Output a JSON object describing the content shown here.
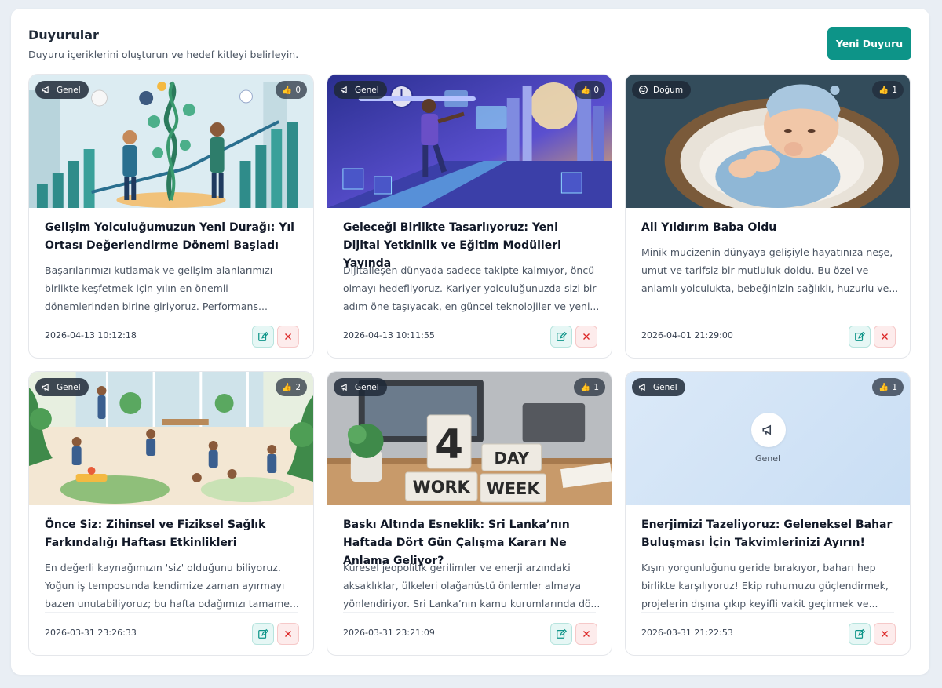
{
  "header": {
    "title": "Duyurular",
    "subtitle": "Duyuru içeriklerini oluşturun ve hedef kitleyi belirleyin.",
    "new_button": "Yeni Duyuru"
  },
  "colors": {
    "accent": "#0d9488",
    "delete": "#dc2626"
  },
  "cards": [
    {
      "category": "Genel",
      "category_icon": "megaphone-icon",
      "likes": "0",
      "title": "Gelişim Yolculuğumuzun Yeni Durağı: Yıl Ortası Değerlendirme Dönemi Başladı",
      "description": "Başarılarımızı kutlamak ve gelişim alanlarımızı birlikte keşfetmek için yılın en önemli dönemlerinden birine giriyoruz. Performans...",
      "date": "2026-04-13 10:12:18"
    },
    {
      "category": "Genel",
      "category_icon": "megaphone-icon",
      "likes": "0",
      "title": "Geleceği Birlikte Tasarlıyoruz: Yeni Dijital Yetkinlik ve Eğitim Modülleri Yayında",
      "description": "Dijitalleşen dünyada sadece takipte kalmıyor, öncü olmayı hedefliyoruz. Kariyer yolculuğunuzda sizi bir adım öne taşıyacak, en güncel teknolojiler ve yeni...",
      "date": "2026-04-13 10:11:55"
    },
    {
      "category": "Doğum",
      "category_icon": "smile-icon",
      "likes": "1",
      "title": "Ali Yıldırım Baba Oldu",
      "description": "Minik mucizenin dünyaya gelişiyle hayatınıza neşe, umut ve tarifsiz bir mutluluk doldu. Bu özel ve anlamlı yolculukta, bebeğinizin sağlıklı, huzurlu ve...",
      "date": "2026-04-01 21:29:00"
    },
    {
      "category": "Genel",
      "category_icon": "megaphone-icon",
      "likes": "2",
      "title": "Önce Siz: Zihinsel ve Fiziksel Sağlık Farkındalığı Haftası Etkinlikleri",
      "description": "En değerli kaynağımızın 'siz' olduğunu biliyoruz. Yoğun iş temposunda kendimize zaman ayırmayı bazen unutabiliyoruz; bu hafta odağımızı tamame...",
      "date": "2026-03-31 23:26:33"
    },
    {
      "category": "Genel",
      "category_icon": "megaphone-icon",
      "likes": "1",
      "title": "Baskı Altında Esneklik: Sri Lanka’nın Haftada Dört Gün Çalışma Kararı Ne Anlama Geliyor?",
      "description": "Küresel jeopolitik gerilimler ve enerji arzındaki aksaklıklar, ülkeleri olağanüstü önlemler almaya yönlendiriyor. Sri Lanka’nın kamu kurumlarında dö...",
      "date": "2026-03-31 23:21:09",
      "image_text": {
        "number": "4",
        "day": "DAY",
        "work": "WORK",
        "week": "WEEK"
      }
    },
    {
      "category": "Genel",
      "category_icon": "megaphone-icon",
      "likes": "1",
      "placeholder_label": "Genel",
      "title": "Enerjimizi Tazeliyoruz: Geleneksel Bahar Buluşması İçin Takvimlerinizi Ayırın!",
      "description": "Kışın yorgunluğunu geride bırakıyor, baharı hep birlikte karşılıyoruz! Ekip ruhumuzu güçlendirmek, projelerin dışına çıkıp keyifli vakit geçirmek ve...",
      "date": "2026-03-31 21:22:53"
    }
  ]
}
